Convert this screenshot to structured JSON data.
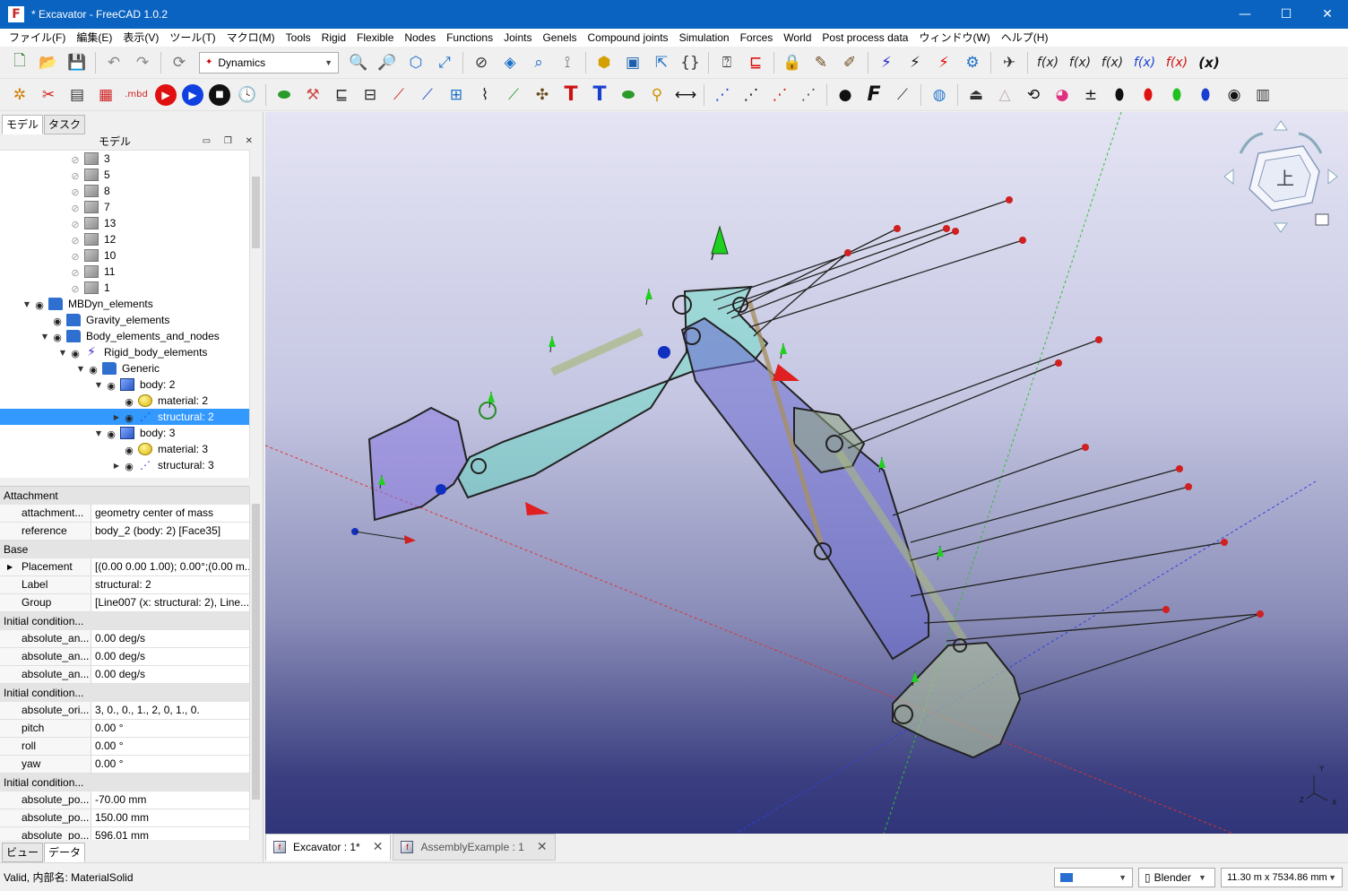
{
  "window": {
    "title": "* Excavator - FreeCAD 1.0.2",
    "minimize": "—",
    "maximize": "☐",
    "close": "✕"
  },
  "menu": [
    "ファイル(F)",
    "編集(E)",
    "表示(V)",
    "ツール(T)",
    "マクロ(M)",
    "Tools",
    "Rigid",
    "Flexible",
    "Nodes",
    "Functions",
    "Joints",
    "Genels",
    "Compound joints",
    "Simulation",
    "Forces",
    "World",
    "Post process data",
    "ウィンドウ(W)",
    "ヘルプ(H)"
  ],
  "toolbar": {
    "workbench": "Dynamics",
    "mbd_label": ".mbd",
    "fx_labels": [
      "f(x)",
      "f(x)",
      "f(x)",
      "f(x)",
      "f(x)",
      "(x)"
    ],
    "text_tool": "T",
    "font_tool": "F"
  },
  "left_panel": {
    "tabs": [
      "モデル",
      "タスク"
    ],
    "header": "モデル",
    "bottom_tabs": [
      "ビュー",
      "データ"
    ]
  },
  "tree": [
    {
      "label": "3",
      "icon": "box",
      "eye": "hidden",
      "indent": 0,
      "arrow": ""
    },
    {
      "label": "5",
      "icon": "box",
      "eye": "hidden",
      "indent": 0,
      "arrow": ""
    },
    {
      "label": "8",
      "icon": "box",
      "eye": "hidden",
      "indent": 0,
      "arrow": ""
    },
    {
      "label": "7",
      "icon": "box",
      "eye": "hidden",
      "indent": 0,
      "arrow": ""
    },
    {
      "label": "13",
      "icon": "box",
      "eye": "hidden",
      "indent": 0,
      "arrow": ""
    },
    {
      "label": "12",
      "icon": "box",
      "eye": "hidden",
      "indent": 0,
      "arrow": ""
    },
    {
      "label": "10",
      "icon": "box",
      "eye": "hidden",
      "indent": 0,
      "arrow": ""
    },
    {
      "label": "11",
      "icon": "box",
      "eye": "hidden",
      "indent": 0,
      "arrow": ""
    },
    {
      "label": "1",
      "icon": "box",
      "eye": "hidden",
      "indent": 0,
      "arrow": ""
    },
    {
      "label": "MBDyn_elements",
      "icon": "folder",
      "eye": "visible",
      "indent": -1,
      "arrow": "down"
    },
    {
      "label": "Gravity_elements",
      "icon": "folder",
      "eye": "visible",
      "indent": 0,
      "arrow": ""
    },
    {
      "label": "Body_elements_and_nodes",
      "icon": "folder",
      "eye": "visible",
      "indent": 0,
      "arrow": "down"
    },
    {
      "label": "Rigid_body_elements",
      "icon": "bolt",
      "eye": "visible",
      "indent": 1,
      "arrow": "down"
    },
    {
      "label": "Generic",
      "icon": "folder",
      "eye": "visible",
      "indent": 2,
      "arrow": "down"
    },
    {
      "label": "body: 2",
      "icon": "boxblue",
      "eye": "visible",
      "indent": 3,
      "arrow": "down"
    },
    {
      "label": "material: 2",
      "icon": "ball",
      "eye": "visible",
      "indent": 4,
      "arrow": ""
    },
    {
      "label": "structural: 2",
      "icon": "axes",
      "eye": "visible",
      "indent": 4,
      "arrow": "right",
      "selected": true
    },
    {
      "label": "body: 3",
      "icon": "boxblue",
      "eye": "visible",
      "indent": 3,
      "arrow": "down"
    },
    {
      "label": "material: 3",
      "icon": "ball",
      "eye": "visible",
      "indent": 4,
      "arrow": ""
    },
    {
      "label": "structural: 3",
      "icon": "axes",
      "eye": "visible",
      "indent": 4,
      "arrow": "right"
    }
  ],
  "properties": [
    {
      "group": "Attachment"
    },
    {
      "key": "attachment...",
      "value": "geometry center of mass"
    },
    {
      "key": "reference",
      "value": "body_2 (body: 2) [Face35]"
    },
    {
      "group": "Base"
    },
    {
      "key": "Placement",
      "value": "[(0.00 0.00 1.00); 0.00°;(0.00 m...",
      "expand": true
    },
    {
      "key": "Label",
      "value": "structural: 2"
    },
    {
      "key": "Group",
      "value": "[Line007 (x: structural: 2), Line..."
    },
    {
      "group": "Initial condition..."
    },
    {
      "key": "absolute_an...",
      "value": "0.00 deg/s"
    },
    {
      "key": "absolute_an...",
      "value": "0.00 deg/s"
    },
    {
      "key": "absolute_an...",
      "value": "0.00 deg/s"
    },
    {
      "group": "Initial condition..."
    },
    {
      "key": "absolute_ori...",
      "value": "3, 0., 0., 1., 2, 0, 1., 0."
    },
    {
      "key": "pitch",
      "value": "0.00 °"
    },
    {
      "key": "roll",
      "value": "0.00 °"
    },
    {
      "key": "yaw",
      "value": "0.00 °"
    },
    {
      "group": "Initial condition..."
    },
    {
      "key": "absolute_po...",
      "value": "-70.00 mm"
    },
    {
      "key": "absolute_po...",
      "value": "150.00 mm"
    },
    {
      "key": "absolute_po...",
      "value": "596.01 mm"
    }
  ],
  "navcube": {
    "face_label": "上"
  },
  "axis_labels": {
    "x": "X",
    "y": "Y",
    "z": "Z"
  },
  "doc_tabs": [
    {
      "label": "Excavator : 1*",
      "active": true
    },
    {
      "label": "AssemblyExample : 1",
      "active": false
    }
  ],
  "status": {
    "message": "Valid, 内部名: MaterialSolid",
    "navigation": "Blender",
    "dimensions": "11.30 m x 7534.86 mm"
  },
  "colors": {
    "titlebar": "#0b63c1",
    "selection": "#0078d7",
    "viewport_top": "#e4e4f4",
    "viewport_bottom": "#30357a"
  }
}
